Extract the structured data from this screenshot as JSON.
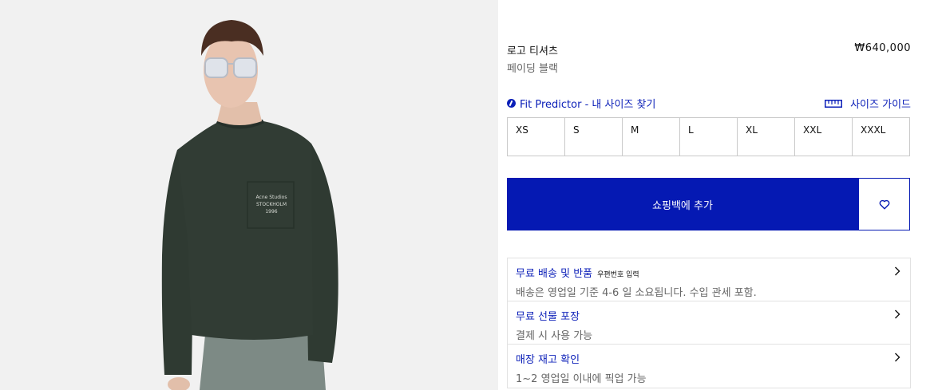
{
  "product": {
    "name": "로고 티셔츠",
    "color_name": "페이딩 블랙",
    "price": "₩640,000"
  },
  "image_print": {
    "line1": "Acne Studios",
    "line2": "STOCKHOLM",
    "line3": "1996"
  },
  "fit_predictor": {
    "label": "Fit Predictor - 내 사이즈 찾기",
    "icon": "fit-predictor-icon"
  },
  "size_guide": {
    "label": "사이즈 가이드",
    "icon": "ruler-icon"
  },
  "sizes": [
    "XS",
    "S",
    "M",
    "L",
    "XL",
    "XXL",
    "XXXL"
  ],
  "add_to_bag": {
    "label": "쇼핑백에 추가"
  },
  "wishlist": {
    "icon": "heart-icon"
  },
  "services": [
    {
      "title": "무료 배송 및 반품",
      "badge": "우편번호 입력",
      "description": "배송은 영업일 기준 4-6 일 소요됩니다. 수입 관세 포함."
    },
    {
      "title": "무료 선물 포장",
      "badge": "",
      "description": "결제 시 사용 가능"
    },
    {
      "title": "매장 재고 확인",
      "badge": "",
      "description": "1~2 영업일 이내에 픽업 가능"
    }
  ],
  "colors": {
    "accent_blue": "#0519b3",
    "shirt": "#2f3a32",
    "background_image": "#f1f1f1"
  }
}
